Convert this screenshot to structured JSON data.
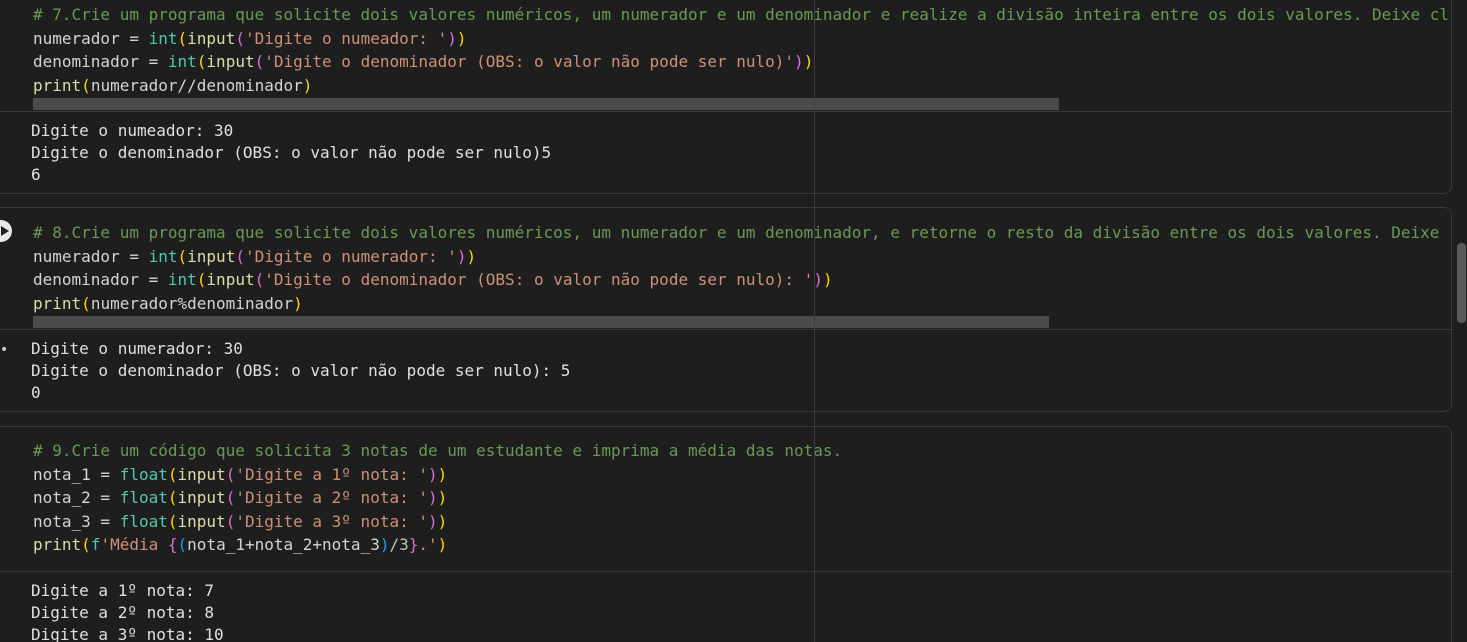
{
  "cells": [
    {
      "code": {
        "comment": "# 7.Crie um programa que solicite dois valores numéricos, um numerador e um denominador e realize a divisão inteira entre os dois valores. Deixe cl",
        "l2_var": "numerador",
        "l2_str": "'Digite o numeador: '",
        "l3_var": "denominador",
        "l3_str": "'Digite o denominador (OBS: o valor não pode ser nulo)'",
        "l4_args": "numerador//denominador"
      },
      "output": [
        "Digite o numeador: 30",
        "Digite o denominador (OBS: o valor não pode ser nulo)5",
        "6"
      ]
    },
    {
      "code": {
        "comment": "# 8.Crie um programa que solicite dois valores numéricos, um numerador e um denominador, e retorne o resto da divisão entre os dois valores. Deixe",
        "l2_var": "numerador",
        "l2_str": "'Digite o numerador: '",
        "l3_var": "denominador",
        "l3_str": "'Digite o denominador (OBS: o valor não pode ser nulo): '",
        "l4_args": "numerador%denominador"
      },
      "output": [
        "Digite o numerador: 30",
        "Digite o denominador (OBS: o valor não pode ser nulo): 5",
        "0"
      ]
    },
    {
      "code": {
        "comment": "# 9.Crie um código que solicita 3 notas de um estudante e imprima a média das notas.",
        "l2_var": "nota_1",
        "l2_str": "'Digite a 1º nota: '",
        "l3_var": "nota_2",
        "l3_str": "'Digite a 2º nota: '",
        "l4_var": "nota_3",
        "l4_str": "'Digite a 3º nota: '",
        "l5_fprefix": "f",
        "l5_str_a": "'Média ",
        "l5_expr": "nota_1+nota_2+nota_3",
        "l5_div": "/3",
        "l5_str_b": ".'"
      },
      "output": [
        "Digite a 1º nota: 7",
        "Digite a 2º nota: 8",
        "Digite a 3º nota: 10"
      ]
    }
  ],
  "tokens": {
    "assign": " = ",
    "int": "int",
    "float": "float",
    "input": "input",
    "print": "print"
  },
  "icons": {
    "run": "play-icon",
    "output_menu": "ellipsis-icon"
  },
  "colors": {
    "background": "#1e1e1e",
    "comment": "#6a9955",
    "string": "#ce9178",
    "builtin_type": "#4ec9b0",
    "function": "#dcdcaa"
  }
}
